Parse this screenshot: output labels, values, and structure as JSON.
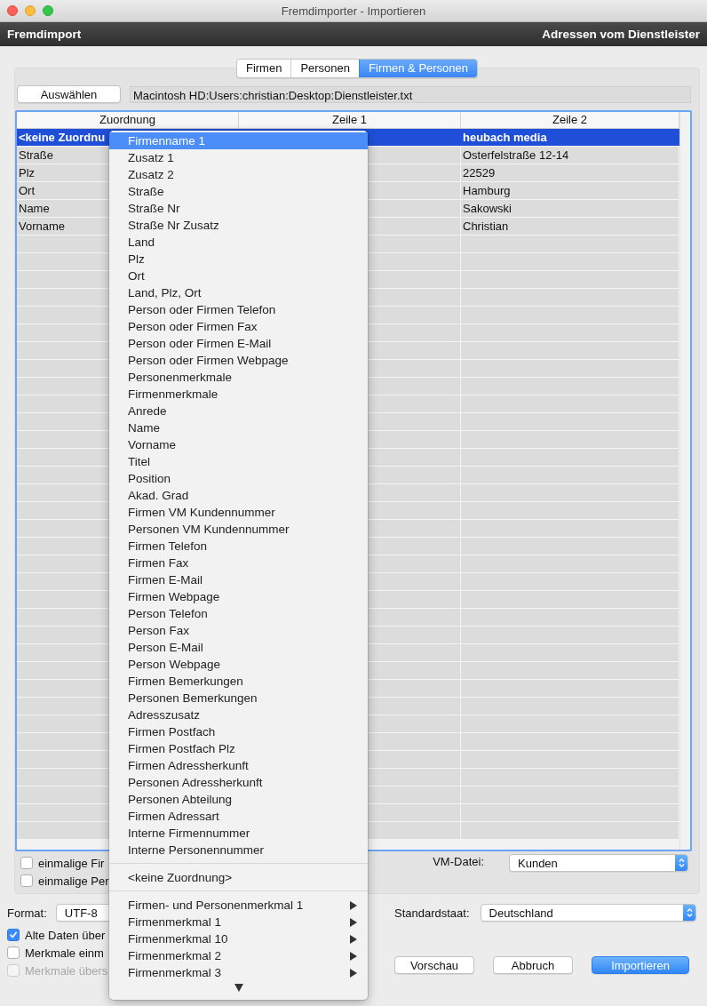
{
  "window": {
    "title": "Fremdimporter - Importieren"
  },
  "header": {
    "title": "Fremdimport",
    "subtitle": "Adressen vom Dienstleister"
  },
  "tabs": [
    {
      "label": "Firmen",
      "selected": false
    },
    {
      "label": "Personen",
      "selected": false
    },
    {
      "label": "Firmen & Personen",
      "selected": true
    }
  ],
  "file": {
    "button": "Auswählen",
    "path": "Macintosh HD:Users:christian:Desktop:Dienstleister.txt"
  },
  "table": {
    "columns": [
      "Zuordnung",
      "Zeile 1",
      "Zeile 2"
    ],
    "rows": [
      {
        "zuordnung": "<keine Zuordnu",
        "zeile_2": "heubach media",
        "selected": true
      },
      {
        "zuordnung": "Straße",
        "zeile_2": "Osterfelstraße 12-14",
        "selected": false
      },
      {
        "zuordnung": "Plz",
        "zeile_2": "22529",
        "selected": false
      },
      {
        "zuordnung": "Ort",
        "zeile_2": "Hamburg",
        "selected": false
      },
      {
        "zuordnung": "Name",
        "zeile_2": "Sakowski",
        "selected": false
      },
      {
        "zuordnung": "Vorname",
        "zeile_2": "Christian",
        "selected": false
      }
    ]
  },
  "group_options": [
    {
      "label": "einmalige Fir",
      "checked": false
    },
    {
      "label": "einmalige Per",
      "checked": false
    }
  ],
  "vm_file": {
    "label": "VM-Datei:",
    "value": "Kunden"
  },
  "format": {
    "label": "Format:",
    "value": "UTF-8"
  },
  "standard_country": {
    "label": "Standardstaat:",
    "value": "Deutschland"
  },
  "options": [
    {
      "label": "Alte Daten über",
      "checked": true,
      "disabled": false
    },
    {
      "label": "Merkmale einm",
      "checked": false,
      "disabled": false
    },
    {
      "label": "Merkmale übers",
      "checked": false,
      "disabled": true
    }
  ],
  "buttons": [
    {
      "label": "Vorschau",
      "default": false
    },
    {
      "label": "Abbruch",
      "default": false
    },
    {
      "label": "Importieren",
      "default": true
    }
  ],
  "menu": {
    "more_below": true,
    "items": [
      {
        "kind": "item",
        "label": "Firmenname 1",
        "selected": true
      },
      {
        "kind": "item",
        "label": "Zusatz 1",
        "selected": false
      },
      {
        "kind": "item",
        "label": "Zusatz 2",
        "selected": false
      },
      {
        "kind": "item",
        "label": "Straße",
        "selected": false
      },
      {
        "kind": "item",
        "label": "Straße Nr",
        "selected": false
      },
      {
        "kind": "item",
        "label": "Straße Nr Zusatz",
        "selected": false
      },
      {
        "kind": "item",
        "label": "Land",
        "selected": false
      },
      {
        "kind": "item",
        "label": "Plz",
        "selected": false
      },
      {
        "kind": "item",
        "label": "Ort",
        "selected": false
      },
      {
        "kind": "item",
        "label": "Land, Plz, Ort",
        "selected": false
      },
      {
        "kind": "item",
        "label": "Person oder Firmen Telefon",
        "selected": false
      },
      {
        "kind": "item",
        "label": "Person oder Firmen Fax",
        "selected": false
      },
      {
        "kind": "item",
        "label": "Person oder Firmen E-Mail",
        "selected": false
      },
      {
        "kind": "item",
        "label": "Person oder Firmen Webpage",
        "selected": false
      },
      {
        "kind": "item",
        "label": "Personenmerkmale",
        "selected": false
      },
      {
        "kind": "item",
        "label": "Firmenmerkmale",
        "selected": false
      },
      {
        "kind": "item",
        "label": "Anrede",
        "selected": false
      },
      {
        "kind": "item",
        "label": "Name",
        "selected": false
      },
      {
        "kind": "item",
        "label": "Vorname",
        "selected": false
      },
      {
        "kind": "item",
        "label": "Titel",
        "selected": false
      },
      {
        "kind": "item",
        "label": "Position",
        "selected": false
      },
      {
        "kind": "item",
        "label": "Akad. Grad",
        "selected": false
      },
      {
        "kind": "item",
        "label": "Firmen VM Kundennummer",
        "selected": false
      },
      {
        "kind": "item",
        "label": "Personen VM Kundennummer",
        "selected": false
      },
      {
        "kind": "item",
        "label": "Firmen Telefon",
        "selected": false
      },
      {
        "kind": "item",
        "label": "Firmen Fax",
        "selected": false
      },
      {
        "kind": "item",
        "label": "Firmen E-Mail",
        "selected": false
      },
      {
        "kind": "item",
        "label": "Firmen Webpage",
        "selected": false
      },
      {
        "kind": "item",
        "label": "Person Telefon",
        "selected": false
      },
      {
        "kind": "item",
        "label": "Person Fax",
        "selected": false
      },
      {
        "kind": "item",
        "label": "Person E-Mail",
        "selected": false
      },
      {
        "kind": "item",
        "label": "Person Webpage",
        "selected": false
      },
      {
        "kind": "item",
        "label": "Firmen Bemerkungen",
        "selected": false
      },
      {
        "kind": "item",
        "label": "Personen Bemerkungen",
        "selected": false
      },
      {
        "kind": "item",
        "label": "Adresszusatz",
        "selected": false
      },
      {
        "kind": "item",
        "label": "Firmen Postfach",
        "selected": false
      },
      {
        "kind": "item",
        "label": "Firmen Postfach Plz",
        "selected": false
      },
      {
        "kind": "item",
        "label": "Firmen Adressherkunft",
        "selected": false
      },
      {
        "kind": "item",
        "label": "Personen Adressherkunft",
        "selected": false
      },
      {
        "kind": "item",
        "label": "Personen Abteilung",
        "selected": false
      },
      {
        "kind": "item",
        "label": "Firmen Adressart",
        "selected": false
      },
      {
        "kind": "item",
        "label": "Interne Firmennummer",
        "selected": false
      },
      {
        "kind": "item",
        "label": "Interne Personennummer",
        "selected": false
      },
      {
        "kind": "separator"
      },
      {
        "kind": "item",
        "label": "<keine Zuordnung>",
        "selected": false
      },
      {
        "kind": "separator"
      },
      {
        "kind": "submenu",
        "label": "Firmen- und Personenmerkmal 1",
        "selected": false
      },
      {
        "kind": "submenu",
        "label": "Firmenmerkmal 1",
        "selected": false
      },
      {
        "kind": "submenu",
        "label": "Firmenmerkmal 10",
        "selected": false
      },
      {
        "kind": "submenu",
        "label": "Firmenmerkmal 2",
        "selected": false
      },
      {
        "kind": "submenu",
        "label": "Firmenmerkmal 3",
        "selected": false
      }
    ]
  }
}
